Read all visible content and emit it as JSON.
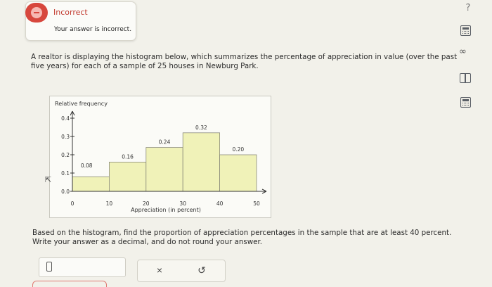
{
  "feedback": {
    "title": "Incorrect",
    "message": "Your answer is incorrect."
  },
  "tools": {
    "help_label": "?",
    "infinity_label": "∞"
  },
  "question": {
    "text": "A realtor is displaying the histogram below, which summarizes the percentage of appreciation in value (over the past five years) for each of a sample of 25 houses in Newburg Park.",
    "prompt": "Based on the histogram, find the proportion of appreciation percentages in the sample that are at least 40 percent. Write your answer as a decimal, and do not round your answer."
  },
  "answer": {
    "value": ""
  },
  "actions": {
    "clear_label": "×",
    "undo_label": "↺"
  },
  "chart_data": {
    "type": "bar",
    "ylabel": "Relative frequency",
    "xlabel": "Appreciation (in percent)",
    "bins": [
      [
        0,
        10
      ],
      [
        10,
        20
      ],
      [
        20,
        30
      ],
      [
        30,
        40
      ],
      [
        40,
        50
      ]
    ],
    "values": [
      0.08,
      0.16,
      0.24,
      0.32,
      0.2
    ],
    "value_labels": [
      "0.08",
      "0.16",
      "0.24",
      "0.32",
      "0.20"
    ],
    "x_ticks": [
      0,
      10,
      20,
      30,
      40,
      50
    ],
    "x_tick_labels": [
      "0",
      "10",
      "20",
      "30",
      "40",
      "50"
    ],
    "y_ticks": [
      0.0,
      0.1,
      0.2,
      0.3,
      0.4
    ],
    "y_tick_labels": [
      "0.0",
      "0.1",
      "0.2",
      "0.3",
      "0.4"
    ],
    "xlim": [
      0,
      50
    ],
    "ylim": [
      0,
      0.4
    ],
    "bar_color": "#f0f2b8",
    "bar_edge": "#8a8a7a",
    "grid": false
  }
}
